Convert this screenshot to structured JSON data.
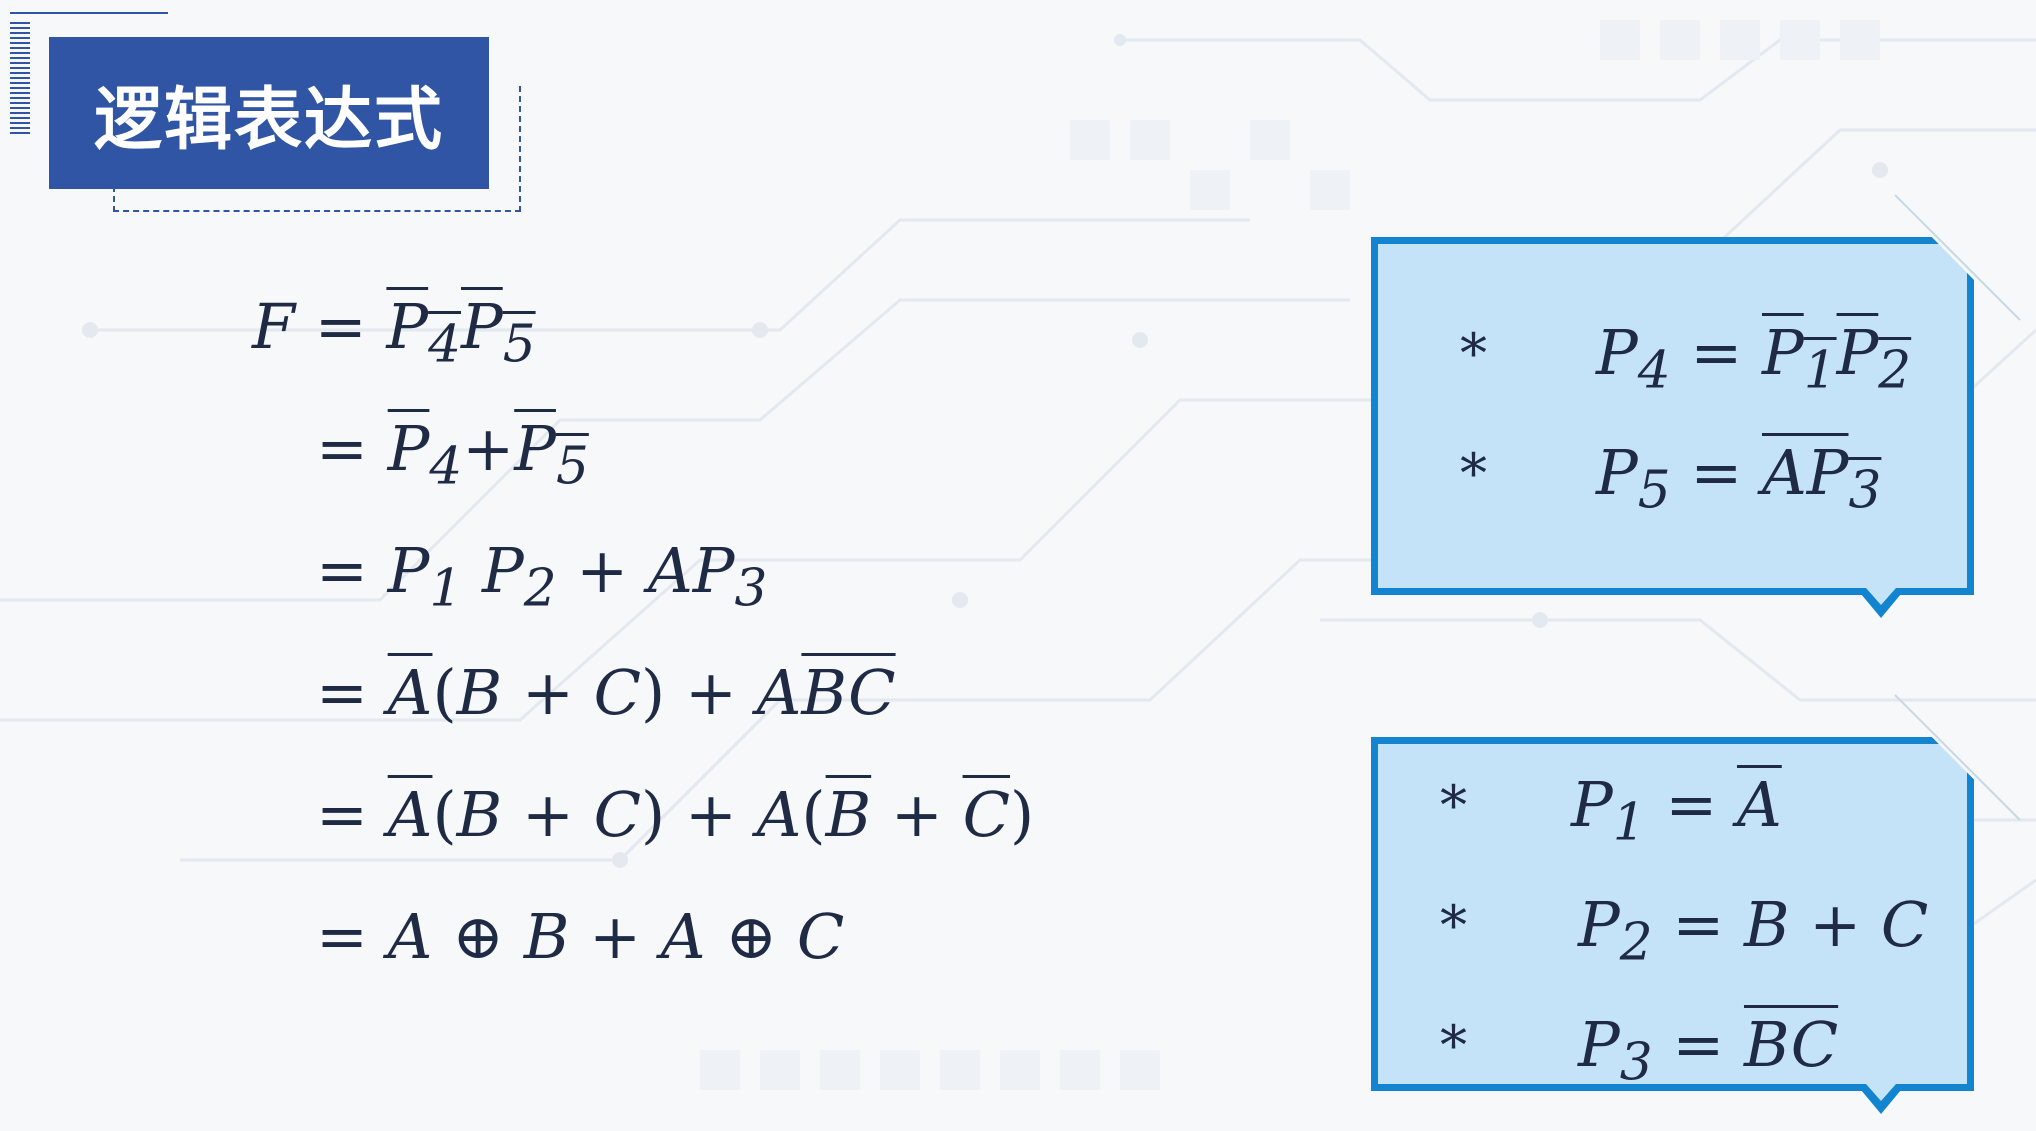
{
  "slide": {
    "title": "逻辑表达式"
  },
  "derivation": {
    "lines": [
      "F = ‾(P₄P₅)",
      "= P̄₄+P̄₅",
      "= P₁ P₂ + AP₃",
      "= Ā(B + C) + A‾(BC)",
      "= Ā(B + C) + A(B̄ + C̄)",
      "= A ⊕ B + A ⊕ C"
    ]
  },
  "definitions_top": {
    "bullet": "*",
    "items": [
      "P₄ = ‾(P₁P₂)",
      "P₅ = ‾(AP₃)"
    ]
  },
  "definitions_bottom": {
    "bullet": "*",
    "items": [
      "P₁ = Ā",
      "P₂ = B + C",
      "P₃ = ‾(BC)"
    ]
  },
  "colors": {
    "title_bg": "#2f55a4",
    "box_fill": "#c5e3f8",
    "box_border": "#1384d0",
    "text": "#1f2a44"
  }
}
